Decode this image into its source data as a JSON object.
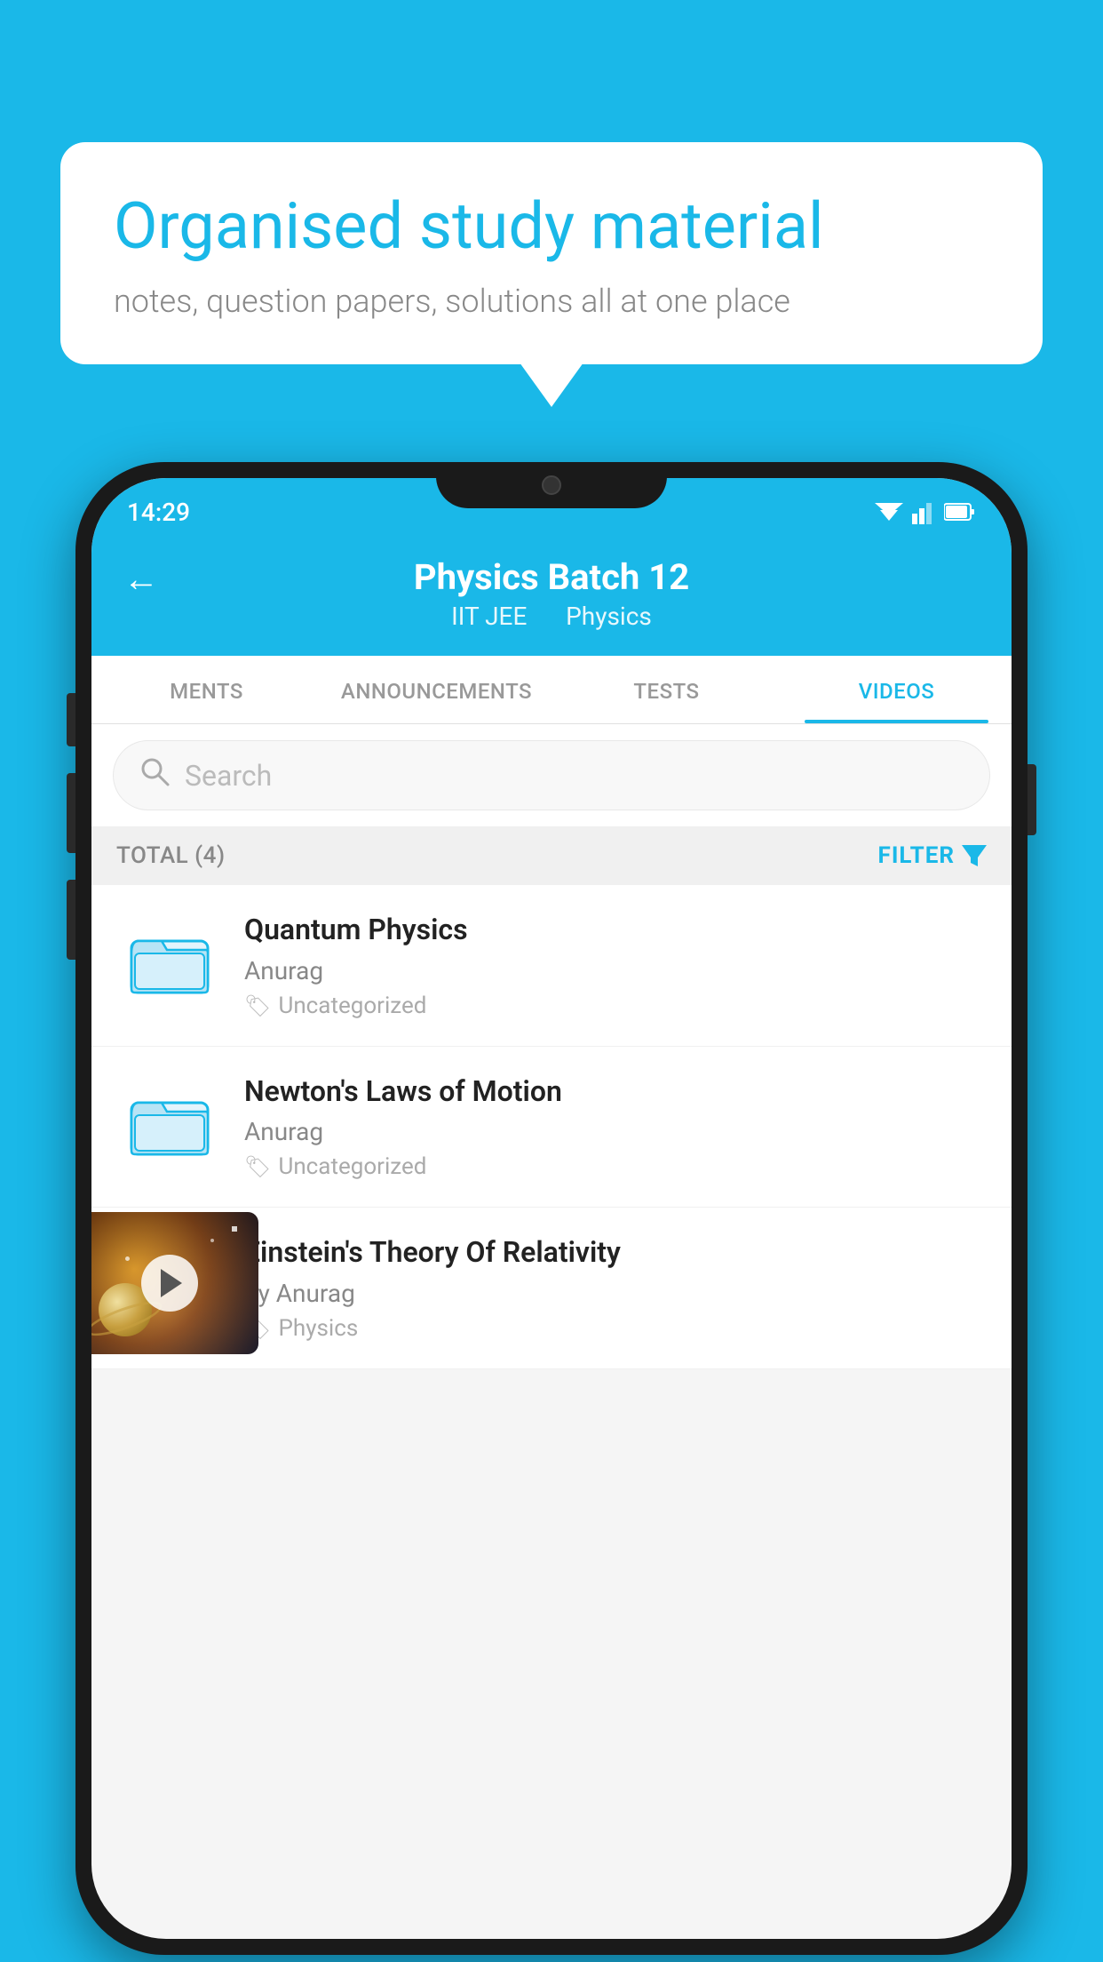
{
  "bubble": {
    "title": "Organised study material",
    "subtitle": "notes, question papers, solutions all at one place"
  },
  "statusBar": {
    "time": "14:29"
  },
  "header": {
    "title": "Physics Batch 12",
    "subtitle1": "IIT JEE",
    "subtitle2": "Physics"
  },
  "tabs": [
    {
      "label": "MENTS",
      "active": false
    },
    {
      "label": "ANNOUNCEMENTS",
      "active": false
    },
    {
      "label": "TESTS",
      "active": false
    },
    {
      "label": "VIDEOS",
      "active": true
    }
  ],
  "search": {
    "placeholder": "Search"
  },
  "filterBar": {
    "total": "TOTAL (4)",
    "filterLabel": "FILTER"
  },
  "videos": [
    {
      "title": "Quantum Physics",
      "author": "Anurag",
      "tag": "Uncategorized",
      "hasThumb": false
    },
    {
      "title": "Newton's Laws of Motion",
      "author": "Anurag",
      "tag": "Uncategorized",
      "hasThumb": false
    },
    {
      "title": "Einstein's Theory Of Relativity",
      "author": "by Anurag",
      "tag": "Physics",
      "hasThumb": true
    }
  ]
}
